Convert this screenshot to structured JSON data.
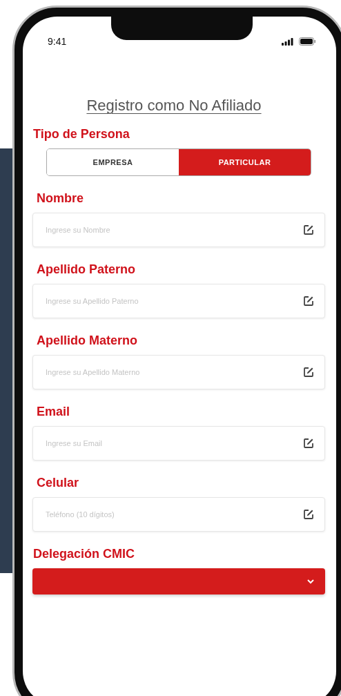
{
  "status_bar": {
    "time": "9:41"
  },
  "title": "Registro como No Afiliado",
  "person_type": {
    "label": "Tipo de Persona",
    "options": [
      {
        "label": "EMPRESA",
        "selected": false
      },
      {
        "label": "PARTICULAR",
        "selected": true
      }
    ]
  },
  "fields": [
    {
      "label": "Nombre",
      "placeholder": "Ingrese su Nombre"
    },
    {
      "label": "Apellido Paterno",
      "placeholder": "Ingrese su Apellido Paterno"
    },
    {
      "label": "Apellido Materno",
      "placeholder": "Ingrese su Apellido Materno"
    },
    {
      "label": "Email",
      "placeholder": "Ingrese su Email"
    },
    {
      "label": "Celular",
      "placeholder": "Teléfono (10 dígitos)"
    }
  ],
  "delegation": {
    "label": "Delegación CMIC"
  }
}
